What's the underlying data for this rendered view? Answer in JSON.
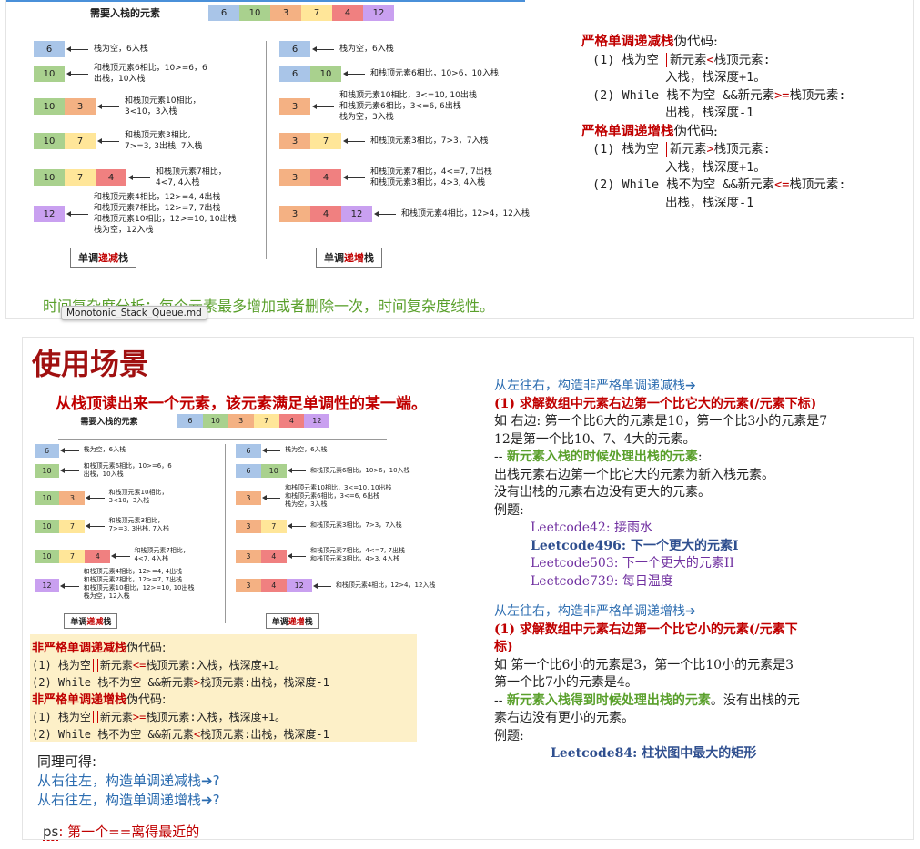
{
  "colors": {
    "c6": "#a9c5e8",
    "c10": "#a9d18e",
    "c3": "#f4b183",
    "c7": "#ffe699",
    "c4": "#f08080",
    "c12": "#c9a0f0"
  },
  "diagram": {
    "title": "需要入栈的元素",
    "header_cells": [
      {
        "v": "6",
        "c": "c6"
      },
      {
        "v": "10",
        "c": "c10"
      },
      {
        "v": "3",
        "c": "c3"
      },
      {
        "v": "7",
        "c": "c7"
      },
      {
        "v": "4",
        "c": "c4"
      },
      {
        "v": "12",
        "c": "c12"
      }
    ],
    "left": {
      "rows": [
        {
          "cells": [
            {
              "v": "6",
              "c": "c6"
            }
          ],
          "note": "栈为空，6入栈"
        },
        {
          "cells": [
            {
              "v": "10",
              "c": "c10"
            }
          ],
          "note": "和栈顶元素6相比，10>=6，6\n出栈，10入栈"
        },
        {
          "cells": [
            {
              "v": "10",
              "c": "c10"
            },
            {
              "v": "3",
              "c": "c3"
            }
          ],
          "note": "和栈顶元素10相比，\n3<10，3入栈"
        },
        {
          "cells": [
            {
              "v": "10",
              "c": "c10"
            },
            {
              "v": "7",
              "c": "c7"
            }
          ],
          "note": "和栈顶元素3相比，\n7>=3, 3出栈, 7入栈"
        },
        {
          "cells": [
            {
              "v": "10",
              "c": "c10"
            },
            {
              "v": "7",
              "c": "c7"
            },
            {
              "v": "4",
              "c": "c4"
            }
          ],
          "note": "和栈顶元素7相比，\n4<7, 4入栈"
        },
        {
          "cells": [
            {
              "v": "12",
              "c": "c12"
            }
          ],
          "note": "和栈顶元素4相比，12>=4, 4出栈\n和栈顶元素7相比，12>=7, 7出栈\n和栈顶元素10相比，12>=10, 10出栈\n栈为空，12入栈"
        }
      ],
      "label_a": "单调",
      "label_b": "递减",
      "label_c": "栈"
    },
    "right": {
      "rows": [
        {
          "cells": [
            {
              "v": "6",
              "c": "c6"
            }
          ],
          "note": "栈为空，6入栈"
        },
        {
          "cells": [
            {
              "v": "6",
              "c": "c6"
            },
            {
              "v": "10",
              "c": "c10"
            }
          ],
          "note": "和栈顶元素6相比，10>6，10入栈"
        },
        {
          "cells": [
            {
              "v": "3",
              "c": "c3"
            }
          ],
          "note": "和栈顶元素10相比，3<=10, 10出栈\n和栈顶元素6相比，3<=6, 6出栈\n栈为空，3入栈"
        },
        {
          "cells": [
            {
              "v": "3",
              "c": "c3"
            },
            {
              "v": "7",
              "c": "c7"
            }
          ],
          "note": "和栈顶元素3相比，7>3，7入栈"
        },
        {
          "cells": [
            {
              "v": "3",
              "c": "c3"
            },
            {
              "v": "4",
              "c": "c4"
            }
          ],
          "note": "和栈顶元素7相比，4<=7, 7出栈\n和栈顶元素3相比，4>3, 4入栈"
        },
        {
          "cells": [
            {
              "v": "3",
              "c": "c3"
            },
            {
              "v": "4",
              "c": "c4"
            },
            {
              "v": "12",
              "c": "c12"
            }
          ],
          "note": "和栈顶元素4相比，12>4，12入栈"
        }
      ],
      "label_a": "单调",
      "label_b": "递增",
      "label_c": "栈"
    }
  },
  "top": {
    "strict_dec_title": "严格单调递减栈",
    "strict_dec_suffix": "伪代码:",
    "strict_dec_1a": "(1) 栈为空",
    "strict_dec_1b": "新元素",
    "strict_dec_1op": "<",
    "strict_dec_1c": "栈顶元素:",
    "strict_dec_1d": "入栈，栈深度+1。",
    "strict_dec_2a": "(2) While 栈不为空 &&新元素",
    "strict_dec_2op": ">=",
    "strict_dec_2c": "栈顶元素:",
    "strict_dec_2d": "出栈，栈深度-1",
    "strict_inc_title": "严格单调递增栈",
    "strict_inc_suffix": "伪代码:",
    "strict_inc_1a": "(1) 栈为空",
    "strict_inc_1b": "新元素",
    "strict_inc_1op": ">",
    "strict_inc_1c": "栈顶元素:",
    "strict_inc_1d": "入栈，栈深度+1。",
    "strict_inc_2a": "(2) While 栈不为空 &&新元素",
    "strict_inc_2op": "<=",
    "strict_inc_2c": "栈顶元素:",
    "strict_inc_2d": "出栈，栈深度-1",
    "complexity": "时间复杂度分析：每个元素最多增加或者删除一次，时间复杂度线性。",
    "tooltip": "Monotonic_Stack_Queue.md"
  },
  "bottom": {
    "heading": "使用场景",
    "subtitle": "从栈顶读出来一个元素，该元素满足单调性的某一端。",
    "ns_dec_title": "非严格单调递减栈",
    "ns_dec_suffix": "伪代码:",
    "ns_dec_1a": "(1) 栈为空",
    "ns_dec_1b": "新元素",
    "ns_dec_1op": "<=",
    "ns_dec_1c": "栈顶元素:入栈，栈深度+1。",
    "ns_dec_2a": "(2) While 栈不为空 &&新元素",
    "ns_dec_2op": ">",
    "ns_dec_2c": "栈顶元素:出栈，栈深度-1",
    "ns_inc_title": "非严格单调递增栈",
    "ns_inc_suffix": "伪代码:",
    "ns_inc_1a": "(1) 栈为空",
    "ns_inc_1b": "新元素",
    "ns_inc_1op": ">=",
    "ns_inc_1c": "栈顶元素:入栈，栈深度+1。",
    "ns_inc_2a": "(2) While 栈不为空 &&新元素",
    "ns_inc_2op": "<",
    "ns_inc_2c": "栈顶元素:出栈，栈深度-1",
    "similar": "同理可得:",
    "rtl_dec": "从右往左，构造单调递减栈➔?",
    "rtl_inc": "从右往左，构造单调递增栈➔?",
    "ps_a": "ps",
    "ps_b": ": 第一个==离得最近的",
    "r1_title": "从左往右，构造非严格单调递减栈➔",
    "r1_q": "(1) 求解数组中元素右边第一个比它大的元素(/元素下标)",
    "r1_ex1": "如 右边: 第一个比6大的元素是10，第一个比3小的元素是7",
    "r1_ex2": "12是第一个比10、7、4大的元素。",
    "r1_dash": "--",
    "r1_hl": "新元素入栈的时候处理出栈的元素",
    "r1_hl_end": ":",
    "r1_a": "出栈元素右边第一个比它大的元素为新入栈元素。",
    "r1_b": "没有出栈的元素右边没有更大的元素。",
    "r1_ex": "例题:",
    "r1_lc": [
      "Leetcode42: 接雨水",
      "Leetcode496: 下一个更大的元素I",
      "Leetcode503: 下一个更大的元素II",
      "Leetcode739: 每日温度"
    ],
    "r2_title": "从左往右，构造非严格单调递增栈➔",
    "r2_q1": "(1) 求解数组中元素右边第一个比它小的元素(/元素下",
    "r2_q2": "标)",
    "r2_ex1": "如 第一个比6小的元素是3，第一个比10小的元素是3",
    "r2_ex2": "第一个比7小的元素是4。",
    "r2_dash": "--",
    "r2_hl": "新元素入栈得到时候处理出栈的元素",
    "r2_tail": "。没有出栈的元",
    "r2_tail2": "素右边没有更小的元素。",
    "r2_ex": "例题:",
    "r2_lc": "Leetcode84: 柱状图中最大的矩形"
  }
}
